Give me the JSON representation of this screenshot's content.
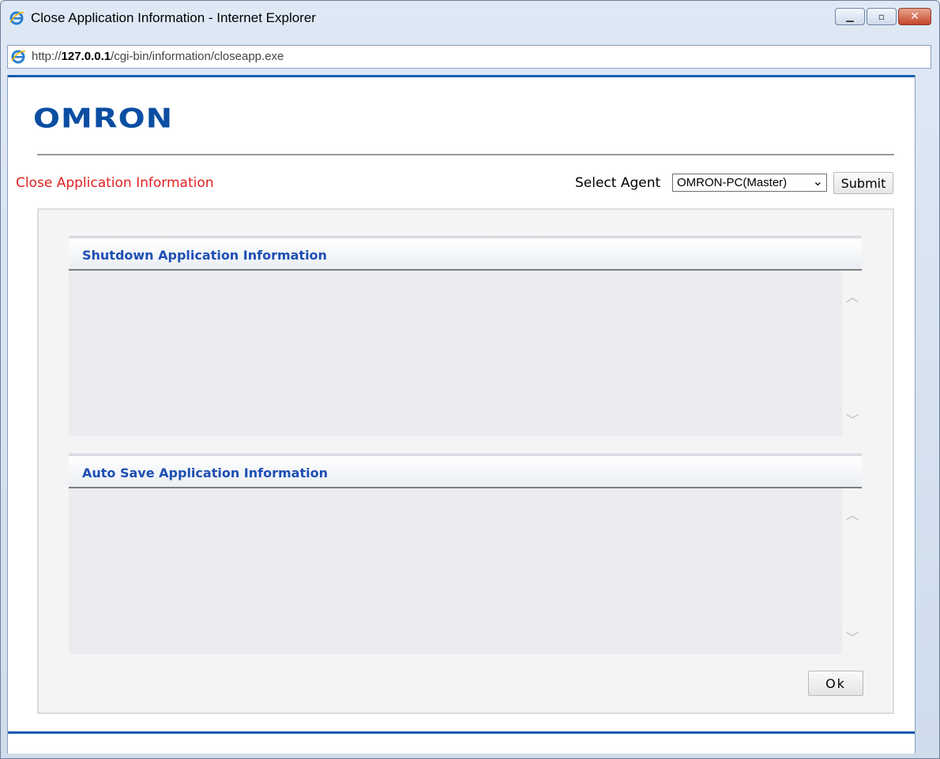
{
  "window": {
    "title": "Close Application Information - Internet Explorer",
    "icon": "internet-explorer-icon",
    "controls": [
      "minimize-icon",
      "maximize-icon",
      "close-icon"
    ]
  },
  "address": {
    "prefix": "http://",
    "host": "127.0.0.1",
    "path": "/cgi-bin/information/closeapp.exe"
  },
  "header": {
    "logo_text": "OMRON",
    "page_title": "Close Application Information",
    "select_agent_label": "Select Agent",
    "agent_selected": "OMRON-PC(Master)",
    "submit_label": "Submit"
  },
  "panels": [
    {
      "title": "Shutdown Application Information",
      "items": []
    },
    {
      "title": "Auto Save Application Information",
      "items": []
    }
  ],
  "footer": {
    "ok_label": "Ok"
  },
  "colors": {
    "accent_blue": "#1a5bb5",
    "logo_blue": "#0b4ea2",
    "title_red": "#e02020",
    "panel_title_blue": "#1e4fb3"
  }
}
